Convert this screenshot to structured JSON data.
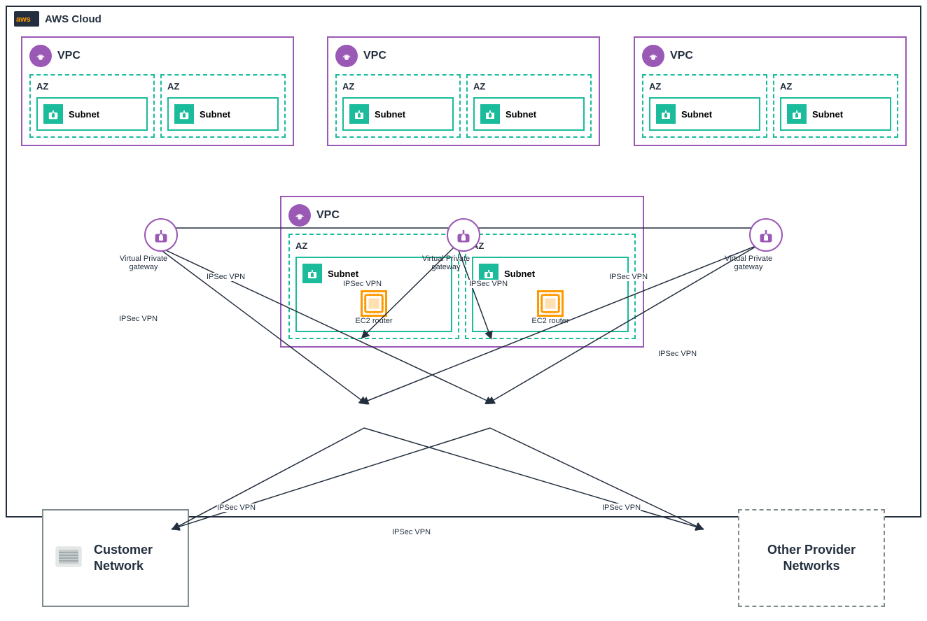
{
  "header": {
    "aws_label": "aws",
    "cloud_label": "AWS Cloud"
  },
  "vpcs_top": [
    {
      "id": "vpc1",
      "label": "VPC",
      "az_boxes": [
        {
          "label": "AZ",
          "subnet": "Subnet"
        },
        {
          "label": "AZ",
          "subnet": "Subnet"
        }
      ]
    },
    {
      "id": "vpc2",
      "label": "VPC",
      "az_boxes": [
        {
          "label": "AZ",
          "subnet": "Subnet"
        },
        {
          "label": "AZ",
          "subnet": "Subnet"
        }
      ]
    },
    {
      "id": "vpc3",
      "label": "VPC",
      "az_boxes": [
        {
          "label": "AZ",
          "subnet": "Subnet"
        },
        {
          "label": "AZ",
          "subnet": "Subnet"
        }
      ]
    }
  ],
  "vpc_center": {
    "label": "VPC",
    "az_boxes": [
      {
        "label": "AZ",
        "subnet": "Subnet",
        "ec2": "EC2 router"
      },
      {
        "label": "AZ",
        "subnet": "Subnet",
        "ec2": "EC2 router"
      }
    ]
  },
  "gateways": [
    {
      "id": "gw1",
      "label": "Virtual Private\ngateway"
    },
    {
      "id": "gw2",
      "label": "Virtual Private\ngateway"
    },
    {
      "id": "gw3",
      "label": "Virtual Private\ngateway"
    }
  ],
  "ipsec_labels": [
    "IPSec VPN",
    "IPSec VPN",
    "IPSec VPN",
    "IPSec VPN",
    "IPSec VPN",
    "IPSec VPN",
    "IPSec VPN",
    "IPSec VPN",
    "IPSec VPN"
  ],
  "customer_network": {
    "label": "Customer\nNetwork"
  },
  "other_networks": {
    "label": "Other Provider\nNetworks"
  }
}
